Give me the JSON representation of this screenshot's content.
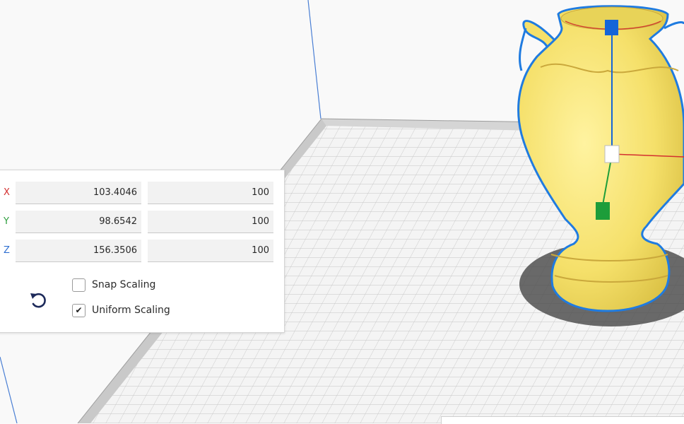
{
  "scale_tool": {
    "axes": [
      {
        "axis": "X",
        "size": "103.4046",
        "percent": "100",
        "color": "#d32f2f"
      },
      {
        "axis": "Y",
        "size": "98.6542",
        "percent": "100",
        "color": "#2e9e3e"
      },
      {
        "axis": "Z",
        "size": "156.3506",
        "percent": "100",
        "color": "#2f6fd0"
      }
    ],
    "reset_icon": "rotate-ccw-icon",
    "snap_scaling": {
      "label": "Snap Scaling",
      "checked": false
    },
    "uniform_scaling": {
      "label": "Uniform Scaling",
      "checked": true
    }
  },
  "viewport": {
    "model_color": "#f7e46e",
    "outline_color": "#1f7be0",
    "grid_color": "#cfcfcf",
    "handle_colors": {
      "z": "#1565d8",
      "y": "#1d9d3a",
      "center": "#ffffff"
    }
  }
}
